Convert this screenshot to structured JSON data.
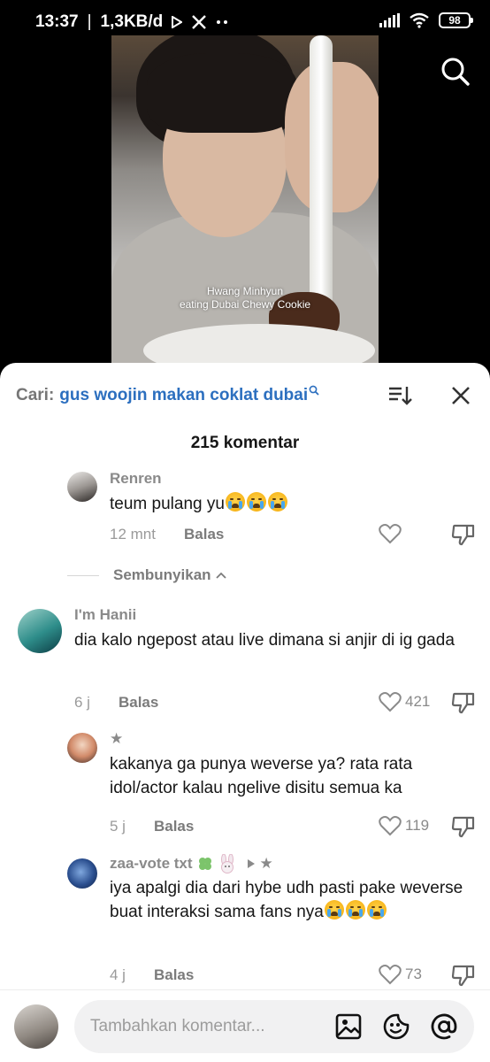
{
  "status_bar": {
    "time": "13:37",
    "speed": "1,3KB/d",
    "battery": "98"
  },
  "video": {
    "caption_line1": "Hwang Minhyun",
    "caption_line2": "eating Dubai Chewy Cookie"
  },
  "comments_sheet": {
    "search_label": "Cari:",
    "search_query": "gus woojin makan coklat dubai",
    "comment_count": "215 komentar",
    "collapse_label": "Sembunyikan",
    "comments": [
      {
        "name": "Renren",
        "text": "teum pulang yu",
        "emoji_count": 3,
        "time": "12 mnt",
        "reply": "Balas",
        "likes": ""
      },
      {
        "name": "I'm Hanii",
        "text": "dia kalo ngepost atau live dimana si anjir di ig gada",
        "time": "6 j",
        "reply": "Balas",
        "likes": "421"
      },
      {
        "name": "★",
        "text": "kakanya ga punya weverse ya? rata rata idol/actor kalau ngelive disitu semua ka",
        "time": "5 j",
        "reply": "Balas",
        "likes": "119"
      },
      {
        "name": "zaa-vote txt",
        "reply_to": "★",
        "text": "iya apalgi dia dari hybe udh pasti pake weverse buat interaksi sama fans nya",
        "emoji_count": 3,
        "time": "4 j",
        "reply": "Balas",
        "likes": "73"
      }
    ]
  },
  "input_bar": {
    "placeholder": "Tambahkan komentar..."
  },
  "colors": {
    "accent_blue": "#2c6fbf",
    "text_primary": "#161616",
    "text_secondary": "#8a8a8a"
  }
}
